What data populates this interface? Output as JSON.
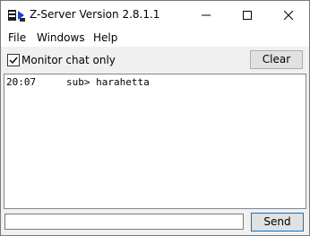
{
  "window": {
    "title": "Z-Server Version 2.8.1.1"
  },
  "menu": {
    "items": [
      "File",
      "Windows",
      "Help"
    ]
  },
  "toolbar": {
    "monitor_label": "Monitor chat only",
    "monitor_checked": true,
    "clear_label": "Clear"
  },
  "log": {
    "entries": [
      {
        "time": "20:07",
        "message": "sub> harahetta"
      }
    ]
  },
  "composer": {
    "input_value": "",
    "send_label": "Send"
  },
  "colors": {
    "focus_border": "#0078d7",
    "button_face": "#e1e1e1"
  }
}
